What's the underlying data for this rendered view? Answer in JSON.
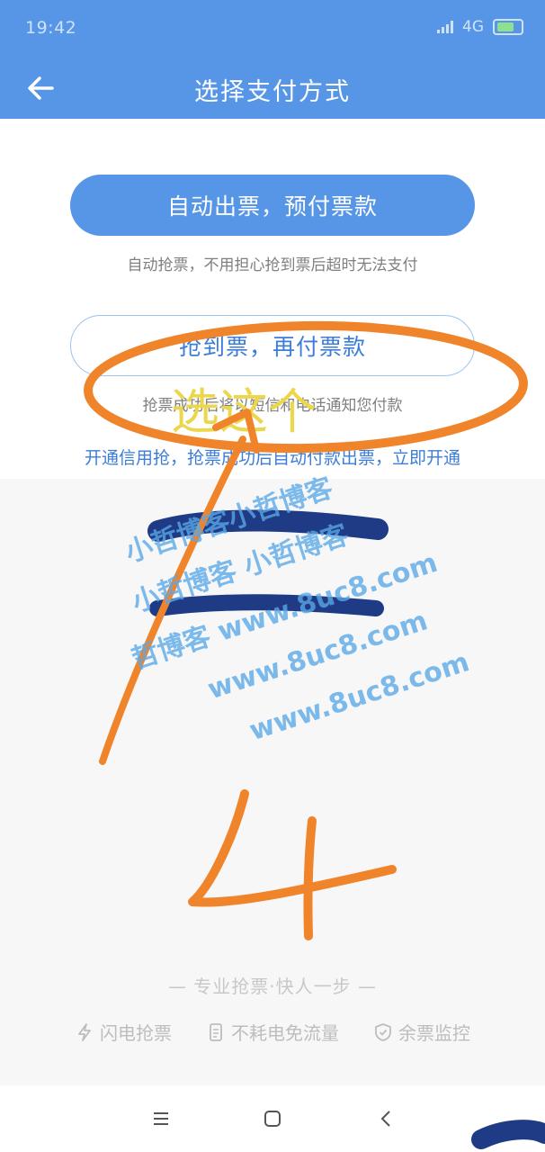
{
  "status_bar": {
    "time": "19:42",
    "network": "4G"
  },
  "header": {
    "title": "选择支付方式"
  },
  "options": [
    {
      "label": "自动出票，预付票款",
      "description": "自动抢票，不用担心抢到票后超时无法支付"
    },
    {
      "label": "抢到票，再付票款",
      "description": "抢票成功后将以短信和电话通知您付款"
    }
  ],
  "credit_link": "开通信用抢，抢票成功后自动付款出票，立即开通",
  "slogan": "— 专业抢票·快人一步 —",
  "features": [
    {
      "icon": "lightning-icon",
      "label": "闪电抢票"
    },
    {
      "icon": "phone-doc-icon",
      "label": "不耗电免流量"
    },
    {
      "icon": "shield-check-icon",
      "label": "余票监控"
    }
  ],
  "annotations": {
    "handwritten_note": "选这个",
    "step_number": "4"
  },
  "watermark": {
    "lines": [
      "小哲博客小哲博客",
      "小哲博客 小哲博客",
      "哲博客 www.8uc8.com",
      "www.8uc8.com",
      "www.8uc8.com"
    ]
  },
  "colors": {
    "primary": "#5796e6",
    "link": "#3b7dd8",
    "annotation": "#f0842a"
  }
}
